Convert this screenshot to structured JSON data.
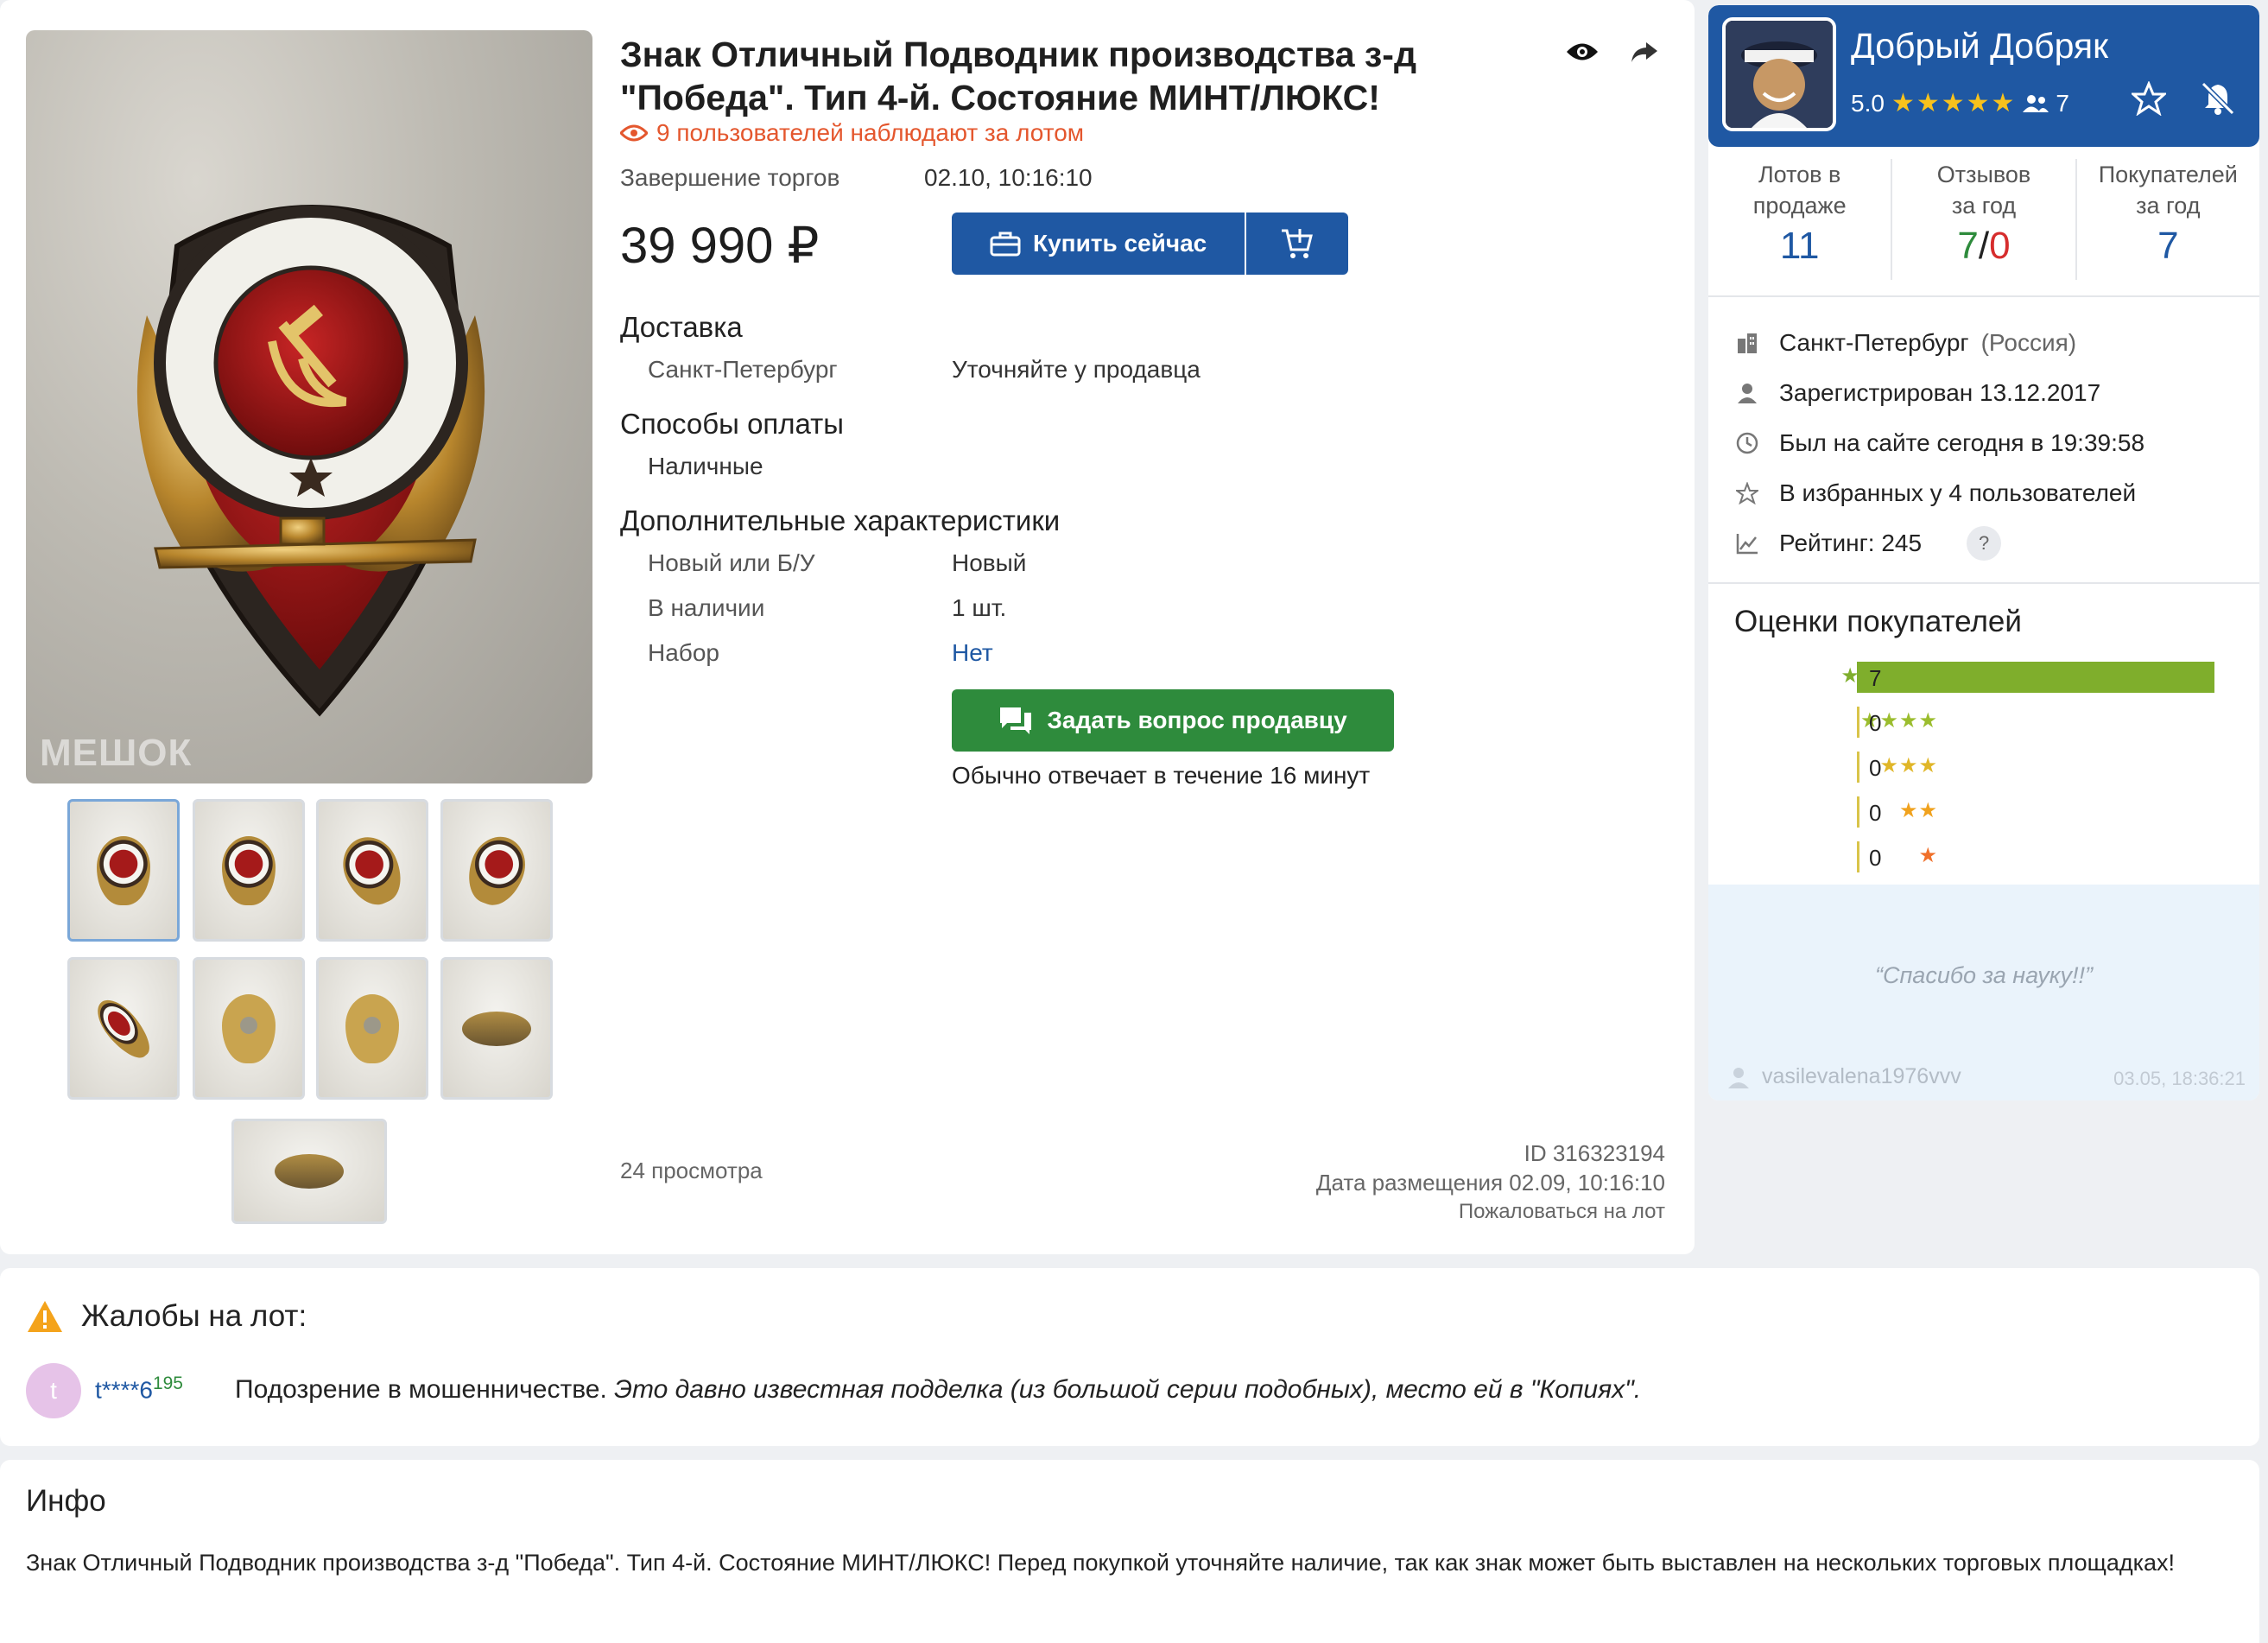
{
  "lot": {
    "title": "Знак Отличный Подводник производства з-д \"Победа\". Тип 4-й. Состояние МИНТ/ЛЮКС!",
    "watchers": "9 пользователей наблюдают за лотом",
    "end_label": "Завершение торгов",
    "end_value": "02.10, 10:16:10",
    "price": "39 990 ₽",
    "buy_now": "Купить сейчас",
    "delivery_h": "Доставка",
    "delivery_city": "Санкт-Петербург",
    "delivery_value": "Уточняйте у продавца",
    "payment_h": "Способы оплаты",
    "payment_value": "Наличные",
    "extra_h": "Дополнительные характеристики",
    "chars": [
      {
        "label": "Новый или Б/У",
        "value": "Новый"
      },
      {
        "label": "В наличии",
        "value": "1 шт."
      },
      {
        "label": "Набор",
        "value": "Нет"
      }
    ],
    "ask_button": "Задать вопрос продавцу",
    "reply_time": "Обычно отвечает в течение 16 минут",
    "views": "24 просмотра",
    "id": "ID 316323194",
    "posted": "Дата размещения 02.09, 10:16:10",
    "report": "Пожаловаться на лот",
    "watermark": "МЕШОК",
    "thumb_count": 9
  },
  "seller": {
    "name": "Добрый Добряк",
    "rating": "5.0",
    "stars": "★★★★★",
    "followers": "7",
    "stats": [
      {
        "caption1": "Лотов в",
        "caption2": "продаже",
        "value": "11"
      },
      {
        "caption1": "Отзывов",
        "caption2": "за год",
        "pos": "7",
        "sep": "/",
        "neg": "0"
      },
      {
        "caption1": "Покупателей",
        "caption2": "за год",
        "value": "7"
      }
    ],
    "city": "Санкт-Петербург",
    "country": "(Россия)",
    "registered": "Зарегистрирован 13.12.2017",
    "last_seen": "Был на сайте сегодня в 19:39:58",
    "favorites": "В избранных у 4 пользователей",
    "rating_label": "Рейтинг: 245",
    "help": "?"
  },
  "buyer_ratings": {
    "title": "Оценки покупателей",
    "rows": [
      {
        "stars": "★★★★★",
        "count": "7",
        "fraction": 1.0,
        "color": "#7fae2c"
      },
      {
        "stars": "★★★★",
        "count": "0",
        "fraction": 0,
        "color": "#9bbd2e"
      },
      {
        "stars": "★★★",
        "count": "0",
        "fraction": 0,
        "color": "#e0b628"
      },
      {
        "stars": "★★",
        "count": "0",
        "fraction": 0,
        "color": "#f0a21e"
      },
      {
        "stars": "★",
        "count": "0",
        "fraction": 0,
        "color": "#f0702a"
      }
    ]
  },
  "review": {
    "text": "“Спасибо за науку!!”",
    "user": "vasilevalena1976vvv",
    "date": "03.05, 18:36:21"
  },
  "complaints": {
    "title": "Жалобы на лот:",
    "avatar_letter": "t",
    "user": "t****6",
    "user_score": "195",
    "reason": "Подозрение в мошенничестве.",
    "comment": "Это давно известная подделка (из большой серии подобных), место ей в \"Копиях\"."
  },
  "info": {
    "title": "Инфо",
    "body": "Знак Отличный Подводник производства з-д \"Победа\". Тип 4-й. Состояние МИНТ/ЛЮКС! Перед покупкой уточняйте наличие, так как знак может быть выставлен на нескольких торговых площадках!"
  },
  "colors": {
    "brand": "#1f58a3",
    "green": "#2e8b3c",
    "alert": "#e4572e"
  }
}
